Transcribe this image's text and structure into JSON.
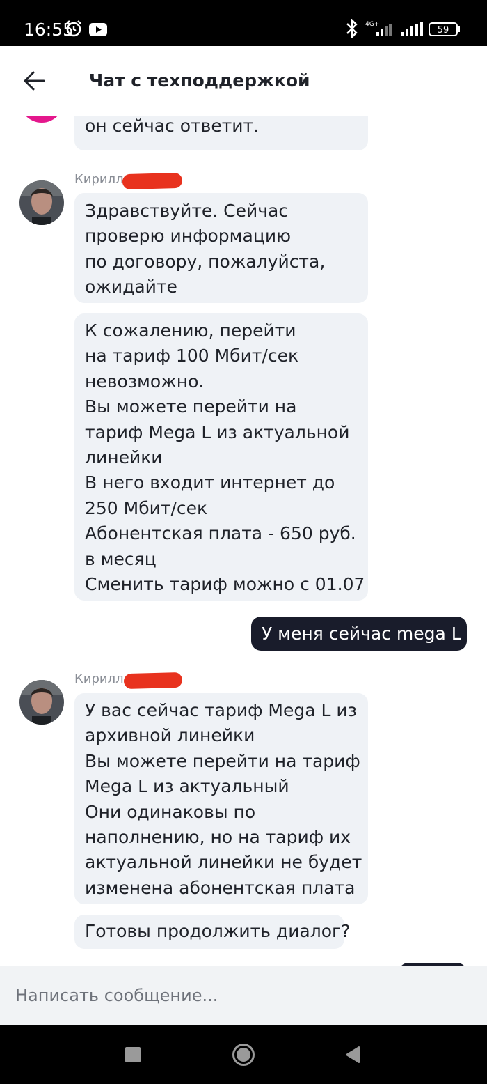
{
  "status_bar": {
    "time": "16:55",
    "network": "4G+",
    "battery": "59",
    "icons": [
      "alarm-icon",
      "youtube-icon",
      "bluetooth-icon",
      "signal-icon",
      "battery-icon"
    ]
  },
  "header": {
    "title": "Чат с техподдержкой",
    "back_icon": "arrow-left-icon"
  },
  "messages": [
    {
      "id": "m0",
      "from": "support",
      "text": "он сейчас ответит."
    },
    {
      "id": "m1",
      "from": "support",
      "sender": "Кирилл",
      "text": "Здравствуйте. Сейчас\nпроверю информацию\nпо договору, пожалуйста,\nожидайте"
    },
    {
      "id": "m2",
      "from": "support",
      "text": "К сожалению, перейти\nна тариф 100 Мбит/сек\nневозможно.\nВы можете перейти на\nтариф Mega L из актуальной\nлинейки\nВ него входит интернет до\n250 Мбит/сек\nАбонентская плата - 650 руб.\nв месяц\nСменить тариф можно с 01.07"
    },
    {
      "id": "m3",
      "from": "user",
      "text": "У меня сейчас mega L"
    },
    {
      "id": "m4",
      "from": "support",
      "sender": "Кирилл",
      "text": "У вас сейчас тариф Mega L из\nархивной линейки\nВы можете перейти на тариф\nMega L из актуальный\nОни одинаковы по\nнаполнению, но на тариф их\nактуальной линейки не будет\nизменена абонентская плата"
    },
    {
      "id": "m5",
      "from": "support",
      "text": "Готовы продолжить диалог?"
    }
  ],
  "composer": {
    "placeholder": "Написать сообщение...",
    "value": ""
  },
  "colors": {
    "user_bubble": "#191c2b",
    "support_bubble": "#eff2f6",
    "redaction": "#e8321e",
    "avatar_accent": "#e4178c"
  },
  "nav_bar": {
    "icons": [
      "recents-square-icon",
      "home-circle-icon",
      "back-triangle-icon"
    ]
  }
}
